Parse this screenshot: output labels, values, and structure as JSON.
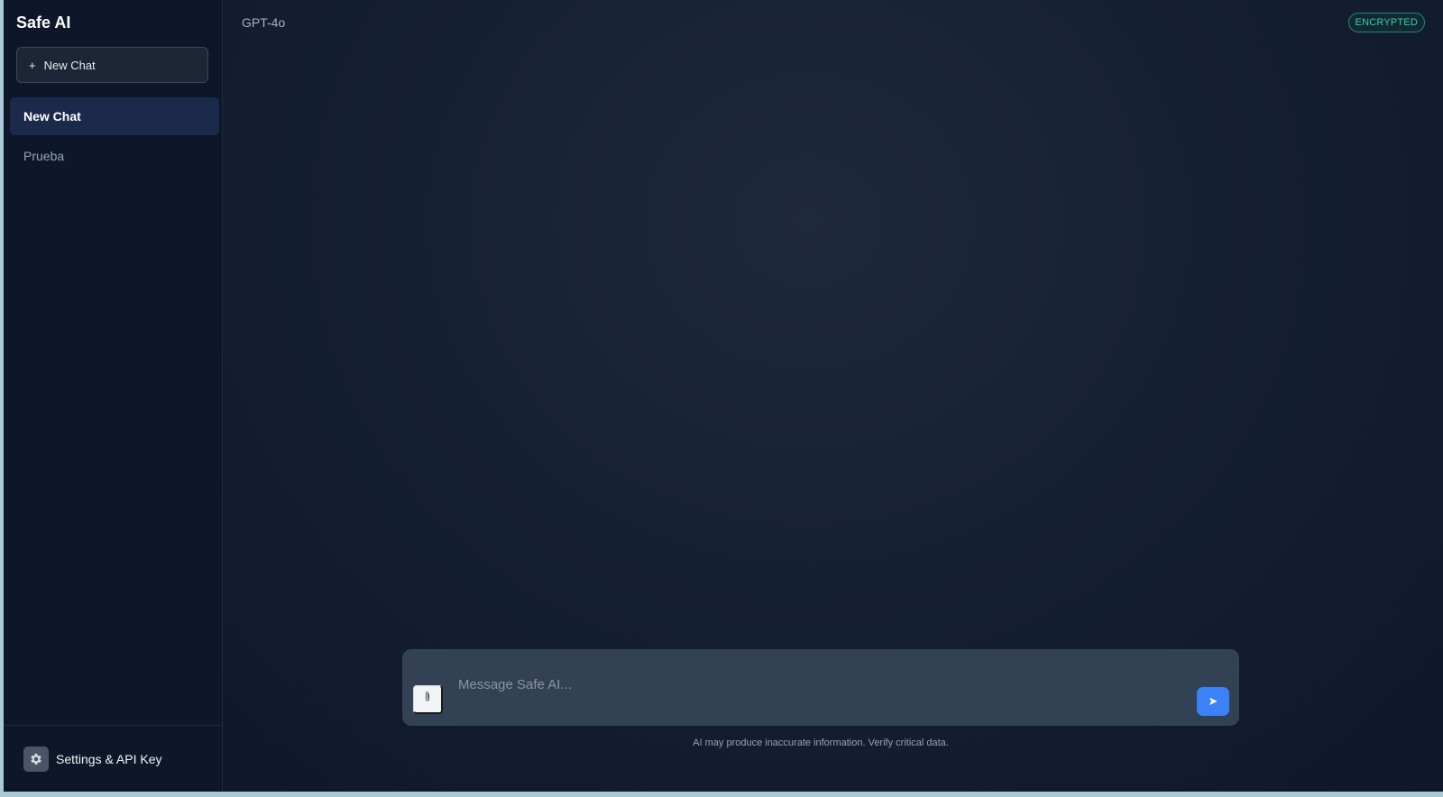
{
  "sidebar": {
    "brand": "Safe AI",
    "new_chat_button": {
      "icon": "+",
      "label": "New Chat"
    },
    "chats": [
      {
        "label": "New Chat",
        "active": true
      },
      {
        "label": "Prueba",
        "active": false
      }
    ],
    "footer": {
      "icon": "gear-icon",
      "label": "Settings & API Key"
    }
  },
  "header": {
    "model": "GPT-4o",
    "badge": "ENCRYPTED"
  },
  "composer": {
    "placeholder": "Message Safe AI...",
    "attach_icon": "paperclip-icon",
    "send_icon": "➤"
  },
  "footer_note": "AI may produce inaccurate information. Verify critical data.",
  "colors": {
    "accent": "#3b82f6",
    "badge": "#34d399",
    "sidebar_active": "#1b2a4a",
    "background": "#0f172a"
  }
}
